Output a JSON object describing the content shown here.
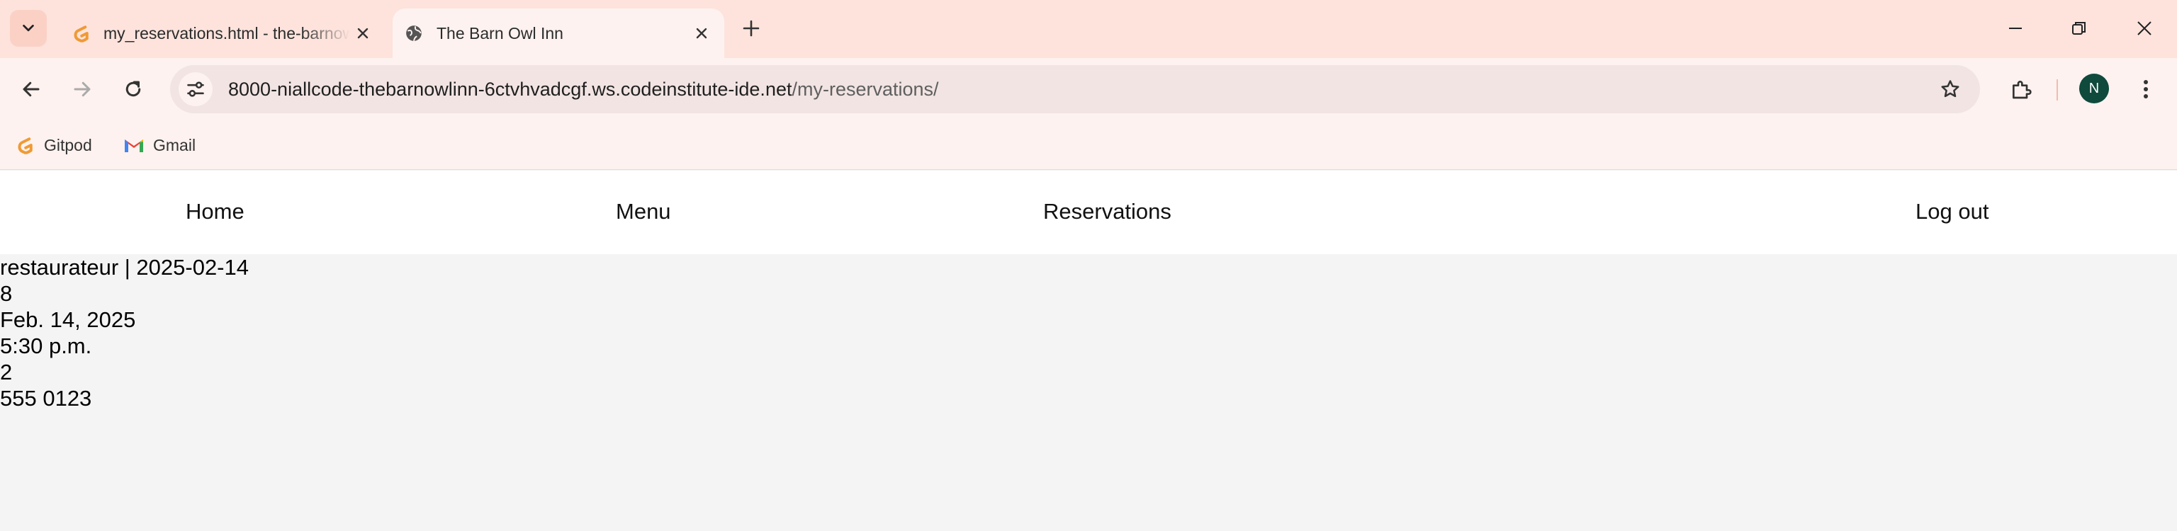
{
  "browser": {
    "tabs": [
      {
        "title": "my_reservations.html - the-barnowlinn",
        "active": false,
        "favicon": "gitpod-icon"
      },
      {
        "title": "The Barn Owl Inn",
        "active": true,
        "favicon": "globe-icon"
      }
    ],
    "address": {
      "host": "8000-niallcode-thebarnowlinn-6ctvhvadcgf.ws.codeinstitute-ide.net",
      "path": "/my-reservations/"
    },
    "profile_initial": "N",
    "bookmarks": [
      {
        "label": "Gitpod",
        "icon": "gitpod-icon"
      },
      {
        "label": "Gmail",
        "icon": "gmail-icon"
      }
    ],
    "colors": {
      "chrome": "#fde3dc",
      "accent": "#f09a35",
      "avatar": "#0f4a3c"
    }
  },
  "nav": {
    "home": "Home",
    "menu": "Menu",
    "reservations": "Reservations",
    "logout": "Log out"
  },
  "reservation": {
    "heading": "restaurateur | 2025-02-14",
    "id": "8",
    "date": "Feb. 14, 2025",
    "time": "5:30 p.m.",
    "guests": "2",
    "phone": "555 0123"
  }
}
